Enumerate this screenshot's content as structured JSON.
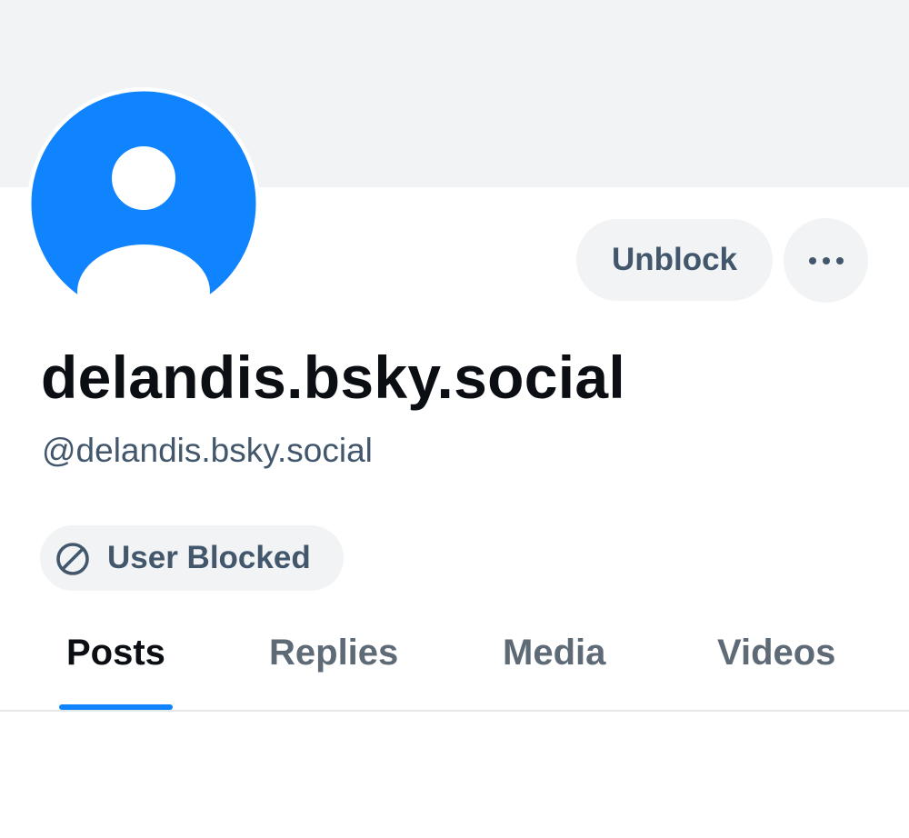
{
  "colors": {
    "accent": "#1083fe",
    "pill_background": "#f1f3f5",
    "muted_text": "#42576c",
    "primary_text": "#0b0f14"
  },
  "profile": {
    "display_name": "delandis.bsky.social",
    "handle": "@delandis.bsky.social",
    "avatar_icon": "default-user-avatar"
  },
  "actions": {
    "unblock_label": "Unblock",
    "more_icon": "ellipsis-icon"
  },
  "status": {
    "blocked_icon": "ban-icon",
    "blocked_label": "User Blocked"
  },
  "tabs": [
    {
      "label": "Posts",
      "active": true
    },
    {
      "label": "Replies",
      "active": false
    },
    {
      "label": "Media",
      "active": false
    },
    {
      "label": "Videos",
      "active": false
    }
  ]
}
